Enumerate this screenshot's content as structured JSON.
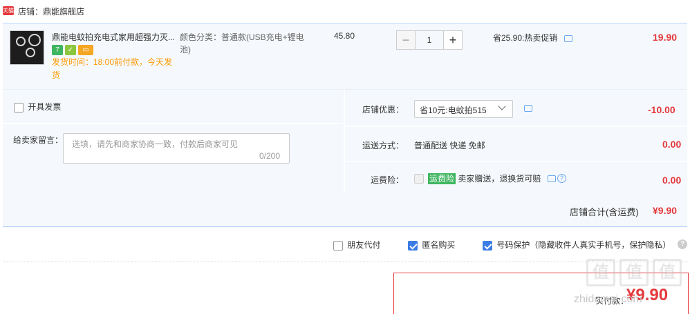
{
  "shop": {
    "badge": "天猫",
    "name_label": "店铺：鼎能旗舰店"
  },
  "item": {
    "title": "鼎能电蚊拍充电式家用超强力灭...",
    "badges": [
      "7",
      "",
      ""
    ],
    "ship_note": "发货时间：18:00前付款，今天发货",
    "sku": "颜色分类：普通款(USB充电+锂电池)",
    "unit_price": "45.80",
    "qty": {
      "minus": "−",
      "value": "1",
      "plus": "+"
    },
    "promo": "省25.90:热卖促销",
    "total": "19.90"
  },
  "invoice": {
    "label": "开具发票"
  },
  "message": {
    "label": "给卖家留言：",
    "placeholder": "选填，请先和商家协商一致，付款后商家可见",
    "count": "0/200"
  },
  "shop_discount": {
    "label": "店铺优惠：",
    "selected": "省10元:电蚊拍515",
    "amount": "-10.00"
  },
  "delivery": {
    "label": "运送方式：",
    "value": "普通配送 快递 免邮",
    "amount": "0.00"
  },
  "insurance": {
    "label": "运费险：",
    "tag": "运费险",
    "desc": "卖家赠送，退换货可赔",
    "amount": "0.00"
  },
  "subtotal": {
    "label": "店铺合计(含运费)",
    "amount": "¥9.90"
  },
  "bottom_options": [
    {
      "label": "朋友代付",
      "checked": false
    },
    {
      "label": "匿名购买",
      "checked": true
    },
    {
      "label": "号码保护（隐藏收件人真实手机号，保护隐私）",
      "checked": true
    }
  ],
  "help": "?",
  "pay": {
    "label": "实付款：",
    "amount": "¥9.90"
  },
  "watermark": {
    "chars": [
      "值",
      "值",
      "值"
    ],
    "site": "zhidemai.com"
  },
  "colors": {
    "price_red": "#e4393c",
    "accent_blue": "#3b7ce6",
    "ship_orange": "#ff9900",
    "row_bg": "#f5f8fc"
  }
}
